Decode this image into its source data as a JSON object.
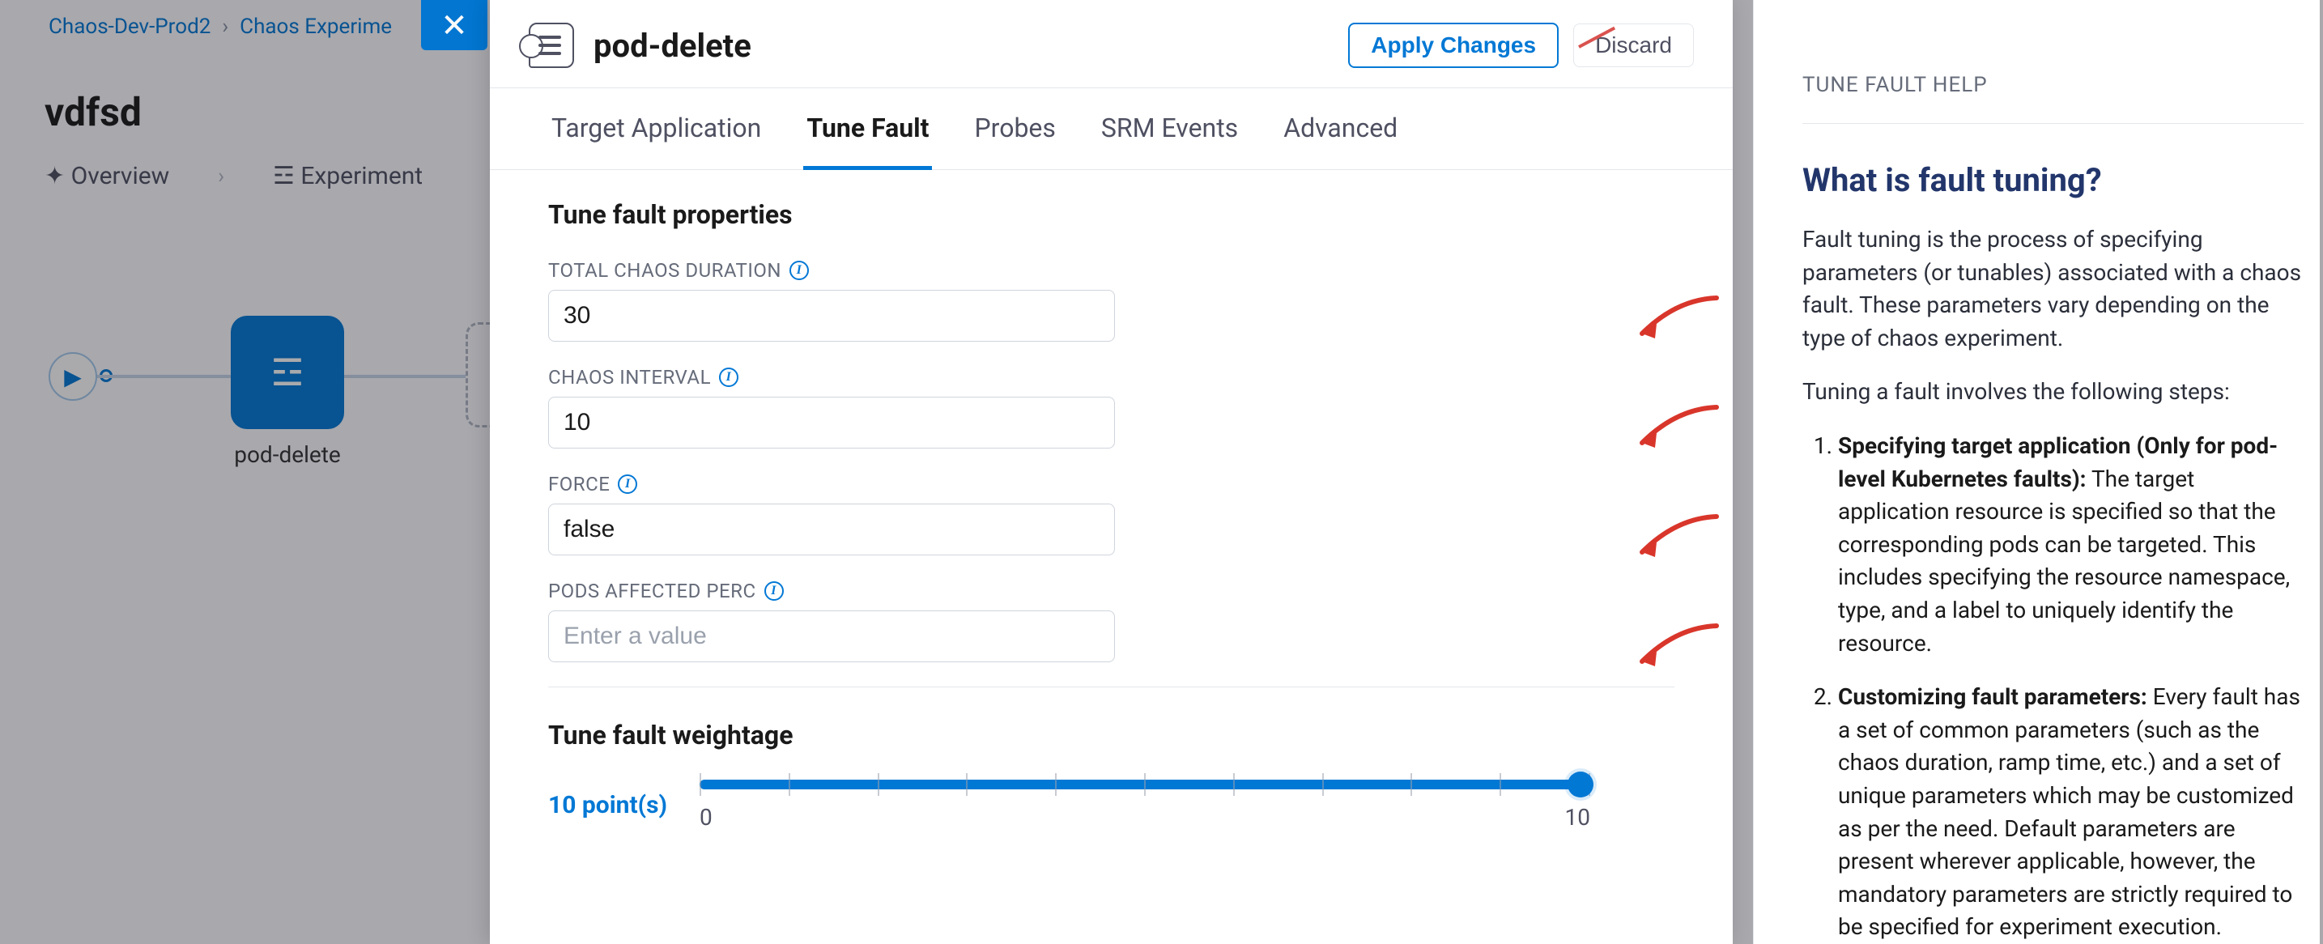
{
  "background": {
    "breadcrumb": {
      "project": "Chaos-Dev-Prod2",
      "section": "Chaos Experime"
    },
    "page_title": "vdfsd",
    "tabs": {
      "overview": "Overview",
      "experiment": "Experiment"
    },
    "node_label": "pod-delete"
  },
  "drawer": {
    "title": "pod-delete",
    "actions": {
      "apply": "Apply Changes",
      "discard": "Discard"
    },
    "tabs": [
      {
        "label": "Target Application",
        "active": false
      },
      {
        "label": "Tune Fault",
        "active": true
      },
      {
        "label": "Probes",
        "active": false
      },
      {
        "label": "SRM Events",
        "active": false
      },
      {
        "label": "Advanced",
        "active": false
      }
    ],
    "section_props": "Tune fault properties",
    "fields": {
      "total_chaos_duration": {
        "label": "Total Chaos Duration",
        "value": "30"
      },
      "chaos_interval": {
        "label": "Chaos Interval",
        "value": "10"
      },
      "force": {
        "label": "Force",
        "value": "false"
      },
      "pods_affected_perc": {
        "label": "Pods Affected Perc",
        "value": "",
        "placeholder": "Enter a value"
      }
    },
    "section_weight": "Tune fault weightage",
    "weight": {
      "display": "10 point(s)",
      "min": "0",
      "max": "10"
    }
  },
  "help": {
    "eyebrow": "Tune Fault Help",
    "title": "What is fault tuning?",
    "intro": "Fault tuning is the process of specifying parameters (or tunables) associated with a chaos fault. These parameters vary depending on the type of chaos experiment.",
    "lead": "Tuning a fault involves the following steps:",
    "steps": [
      {
        "bold": "Specifying target application (Only for pod-level Kubernetes faults):",
        "rest": " The target application resource is specified so that the corresponding pods can be targeted. This includes specifying the resource namespace, type, and a label to uniquely identify the resource."
      },
      {
        "bold": "Customizing fault parameters:",
        "rest": " Every fault has a set of common parameters (such as the chaos duration, ramp time, etc.) and a set of unique parameters which may be customized as per the need. Default parameters are present wherever applicable, however, the mandatory parameters are strictly required to be specified for experiment execution."
      }
    ]
  }
}
